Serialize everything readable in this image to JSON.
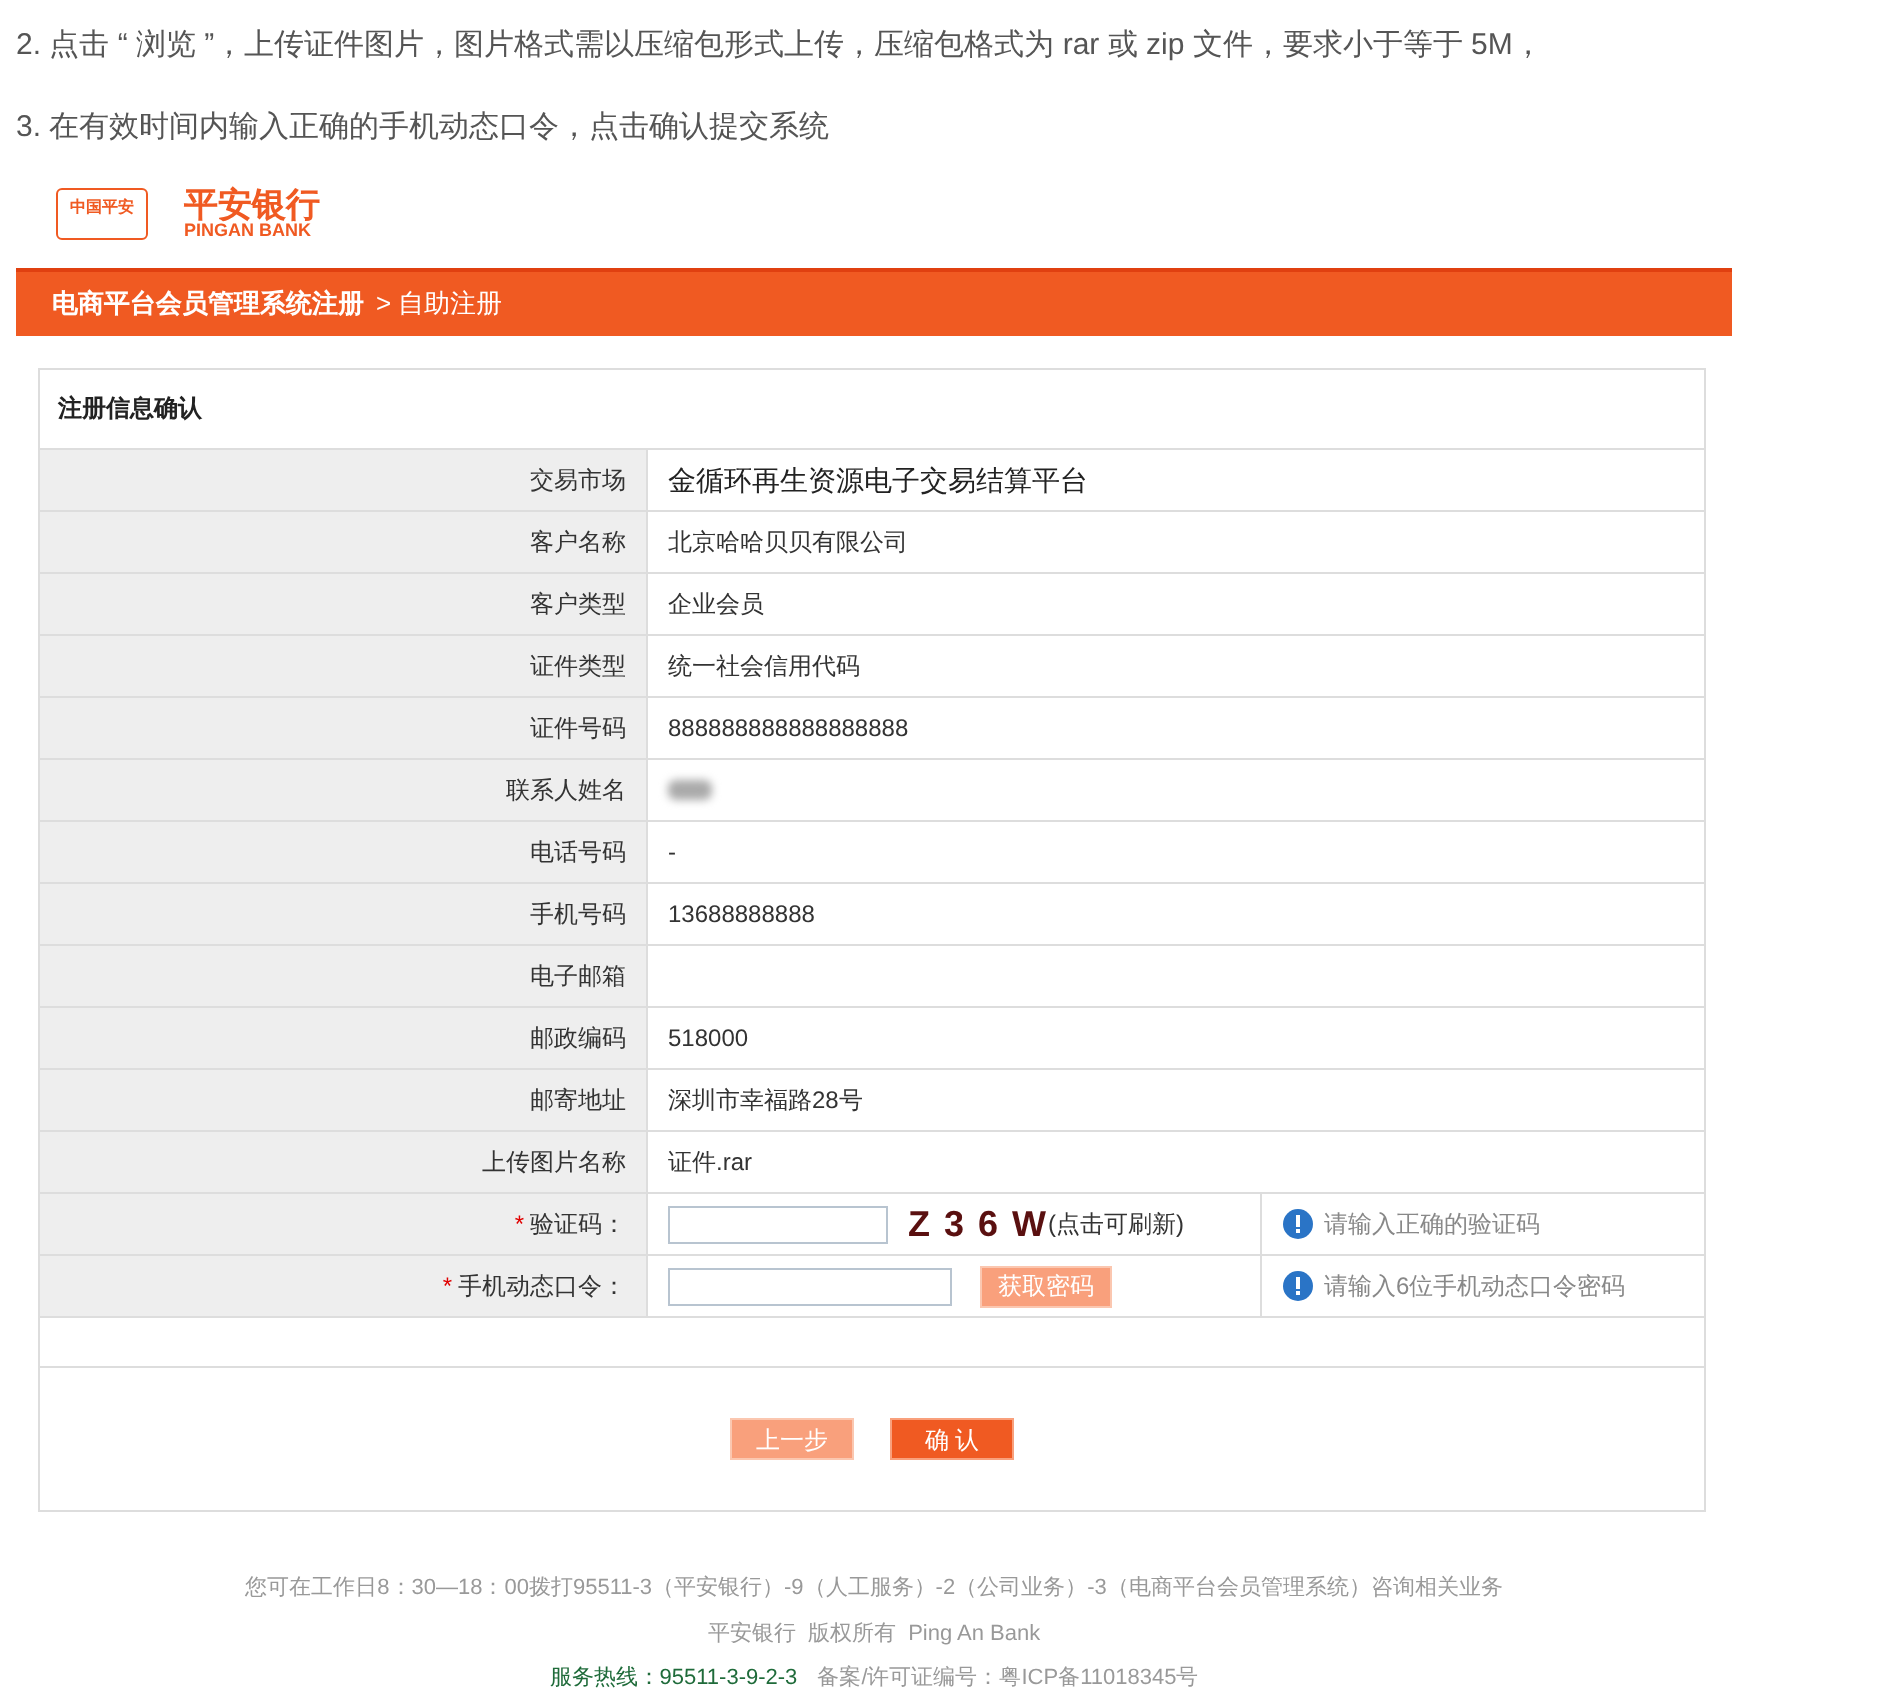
{
  "instructions": [
    "2. 点击 “ 浏览 ”，上传证件图片，图片格式需以压缩包形式上传，压缩包格式为 rar 或 zip 文件，要求小于等于 5M，",
    "3. 在有效时间内输入正确的手机动态口令，点击确认提交系统"
  ],
  "logo": {
    "badge": "中国平安",
    "name": "平安银行",
    "name_en": "PINGAN BANK"
  },
  "breadcrumb": {
    "title": "电商平台会员管理系统注册",
    "current": "> 自助注册"
  },
  "form": {
    "title": "注册信息确认",
    "rows": [
      {
        "kind": "highlight",
        "label": "交易市场",
        "value": "金循环再生资源电子交易结算平台"
      },
      {
        "kind": "text",
        "label": "客户名称",
        "value": "北京哈哈贝贝有限公司"
      },
      {
        "kind": "text",
        "label": "客户类型",
        "value": "企业会员"
      },
      {
        "kind": "text",
        "label": "证件类型",
        "value": "统一社会信用代码"
      },
      {
        "kind": "text",
        "label": "证件号码",
        "value": "888888888888888888"
      },
      {
        "kind": "blurred",
        "label": "联系人姓名"
      },
      {
        "kind": "text",
        "label": "电话号码",
        "value": "-"
      },
      {
        "kind": "text",
        "label": "手机号码",
        "value": "13688888888"
      },
      {
        "kind": "text",
        "label": "电子邮箱"
      },
      {
        "kind": "text",
        "label": "邮政编码",
        "value": "518000"
      },
      {
        "kind": "text",
        "label": "邮寄地址",
        "value": "深圳市幸福路28号"
      },
      {
        "kind": "text",
        "label": "上传图片名称",
        "value": "证件.rar"
      },
      {
        "kind": "captcha",
        "required": "*",
        "label": "验证码：",
        "captcha": "Z 3 6 W",
        "refresh": "(点击可刷新)",
        "hint": "请输入正确的验证码"
      },
      {
        "kind": "sms",
        "required": "*",
        "label": "手机动态口令：",
        "button": "获取密码",
        "hint": "请输入6位手机动态口令密码"
      }
    ],
    "buttons": [
      {
        "kind": "back",
        "label": "上一步"
      },
      {
        "kind": "confirm",
        "label": "确 认"
      }
    ]
  },
  "footer": {
    "line1": "您可在工作日8：30—18：00拨打95511-3（平安银行）-9（人工服务）-2（公司业务）-3（电商平台会员管理系统）咨询相关业务",
    "line2": "平安银行  版权所有  Ping An Bank",
    "hotline": "服务热线：95511-3-9-2-3",
    "icp": "备案/许可证编号：粤ICP备11018345号"
  }
}
